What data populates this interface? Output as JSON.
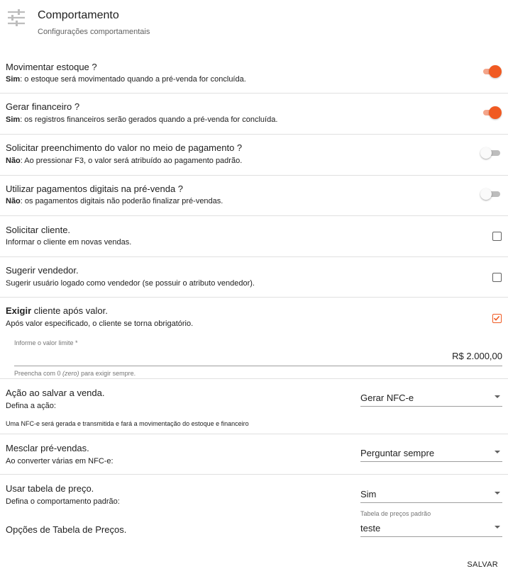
{
  "header": {
    "icon": "sliders-icon",
    "title": "Comportamento",
    "subtitle": "Configurações comportamentais"
  },
  "settings": {
    "movimentar": {
      "title": "Movimentar estoque ?",
      "desc_bold": "Sim",
      "desc": ": o estoque será movimentado quando a pré-venda for concluída.",
      "enabled": true
    },
    "financeiro": {
      "title": "Gerar financeiro ?",
      "desc_bold": "Sim",
      "desc": ": os registros financeiros serão gerados quando a pré-venda for concluída.",
      "enabled": true
    },
    "preenchimento": {
      "title": "Solicitar preenchimento do valor no meio de pagamento ?",
      "desc_bold": "Não",
      "desc": ": Ao pressionar F3, o valor será atribuído ao pagamento padrão.",
      "enabled": false
    },
    "digitais": {
      "title": "Utilizar pagamentos digitais na pré-venda ?",
      "desc_bold": "Não",
      "desc": ": os pagamentos digitais não poderão finalizar pré-vendas.",
      "enabled": false
    },
    "cliente": {
      "title": "Solicitar cliente.",
      "desc": "Informar o cliente em novas vendas.",
      "checked": false
    },
    "vendedor": {
      "title": "Sugerir vendedor.",
      "desc": "Sugerir usuário logado como vendedor (se possuir o atributo vendedor).",
      "checked": false
    },
    "exigir": {
      "title_bold": "Exigir",
      "title": " cliente após valor.",
      "desc": "Após valor especificado, o cliente se torna obrigatório.",
      "checked": true,
      "field_label": "Informe o valor limite *",
      "field_value": "R$ 2.000,00",
      "hint_pre": "Preencha com 0 ",
      "hint_italic": "(zero)",
      "hint_post": " para exigir sempre."
    },
    "acao": {
      "title": "Ação ao salvar a venda.",
      "desc": "Defina a ação:",
      "select_value": "Gerar NFC-e",
      "note": "Uma NFC-e será gerada e transmitida e fará a movimentação do estoque e financeiro"
    },
    "mesclar": {
      "title": "Mesclar pré-vendas.",
      "desc": "Ao converter várias em NFC-e:",
      "select_value": "Perguntar sempre"
    },
    "tabela": {
      "title": "Usar tabela de preço.",
      "desc": "Defina o comportamento padrão:",
      "select_value": "Sim"
    },
    "opcoes": {
      "title": "Opções de Tabela de Preços.",
      "select_label": "Tabela de preços padrão",
      "select_value": "teste"
    }
  },
  "actions": {
    "save_label": "SALVAR"
  },
  "colors": {
    "accent": "#f05a22",
    "accent_light": "#f4a58a",
    "divider": "#e0e0e0"
  }
}
